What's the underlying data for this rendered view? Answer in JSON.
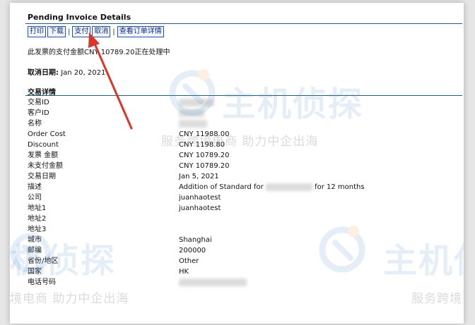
{
  "invoice": {
    "title": "Pending Invoice Details",
    "toolbar": [
      "打印",
      "下载",
      "支付",
      "取消",
      "查看订单详情"
    ],
    "message": "此发票的支付金额CNY 10789.20正在处理中",
    "cancel_label": "取消日期:",
    "cancel_value": "Jan 20, 2021",
    "section_title": "交易详情",
    "rows": [
      {
        "label": "交易ID",
        "value": ""
      },
      {
        "label": "客户ID",
        "value": ""
      },
      {
        "label": "名称",
        "value": ""
      },
      {
        "label": "Order Cost",
        "value": "CNY 11988.00"
      },
      {
        "label": "Discount",
        "value": "CNY 1198.80"
      },
      {
        "label": "发票 金额",
        "value": "CNY 10789.20"
      },
      {
        "label": "未支付金额",
        "value": "CNY 10789.20"
      },
      {
        "label": "交易日期",
        "value": "Jan 5, 2021"
      },
      {
        "label": "描述",
        "value": "Addition of Standard for",
        "value_tail": "for 12 months"
      },
      {
        "label": "公司",
        "value": "juanhaotest"
      },
      {
        "label": "地址1",
        "value": "juanhaotest"
      },
      {
        "label": "地址2",
        "value": ""
      },
      {
        "label": "地址3",
        "value": ""
      },
      {
        "label": "城市",
        "value": "Shanghai"
      },
      {
        "label": "邮编",
        "value": "200000"
      },
      {
        "label": "省份/地区",
        "value": "Other"
      },
      {
        "label": "国家",
        "value": "HK"
      },
      {
        "label": "电话号码",
        "value": ""
      }
    ]
  },
  "watermark": {
    "brand": "主机侦探",
    "brand_partial": "机侦探",
    "slogan": "服务跨境电商  助力中企出海",
    "slogan_left": "境电商  助力中企出海",
    "slogan_right": "服务跨境"
  },
  "colors": {
    "accent_rule": "#1f5f7a",
    "toolbar_border": "#2a4f9e",
    "watermark": "#3d86c6",
    "arrow": "#d9362b"
  }
}
